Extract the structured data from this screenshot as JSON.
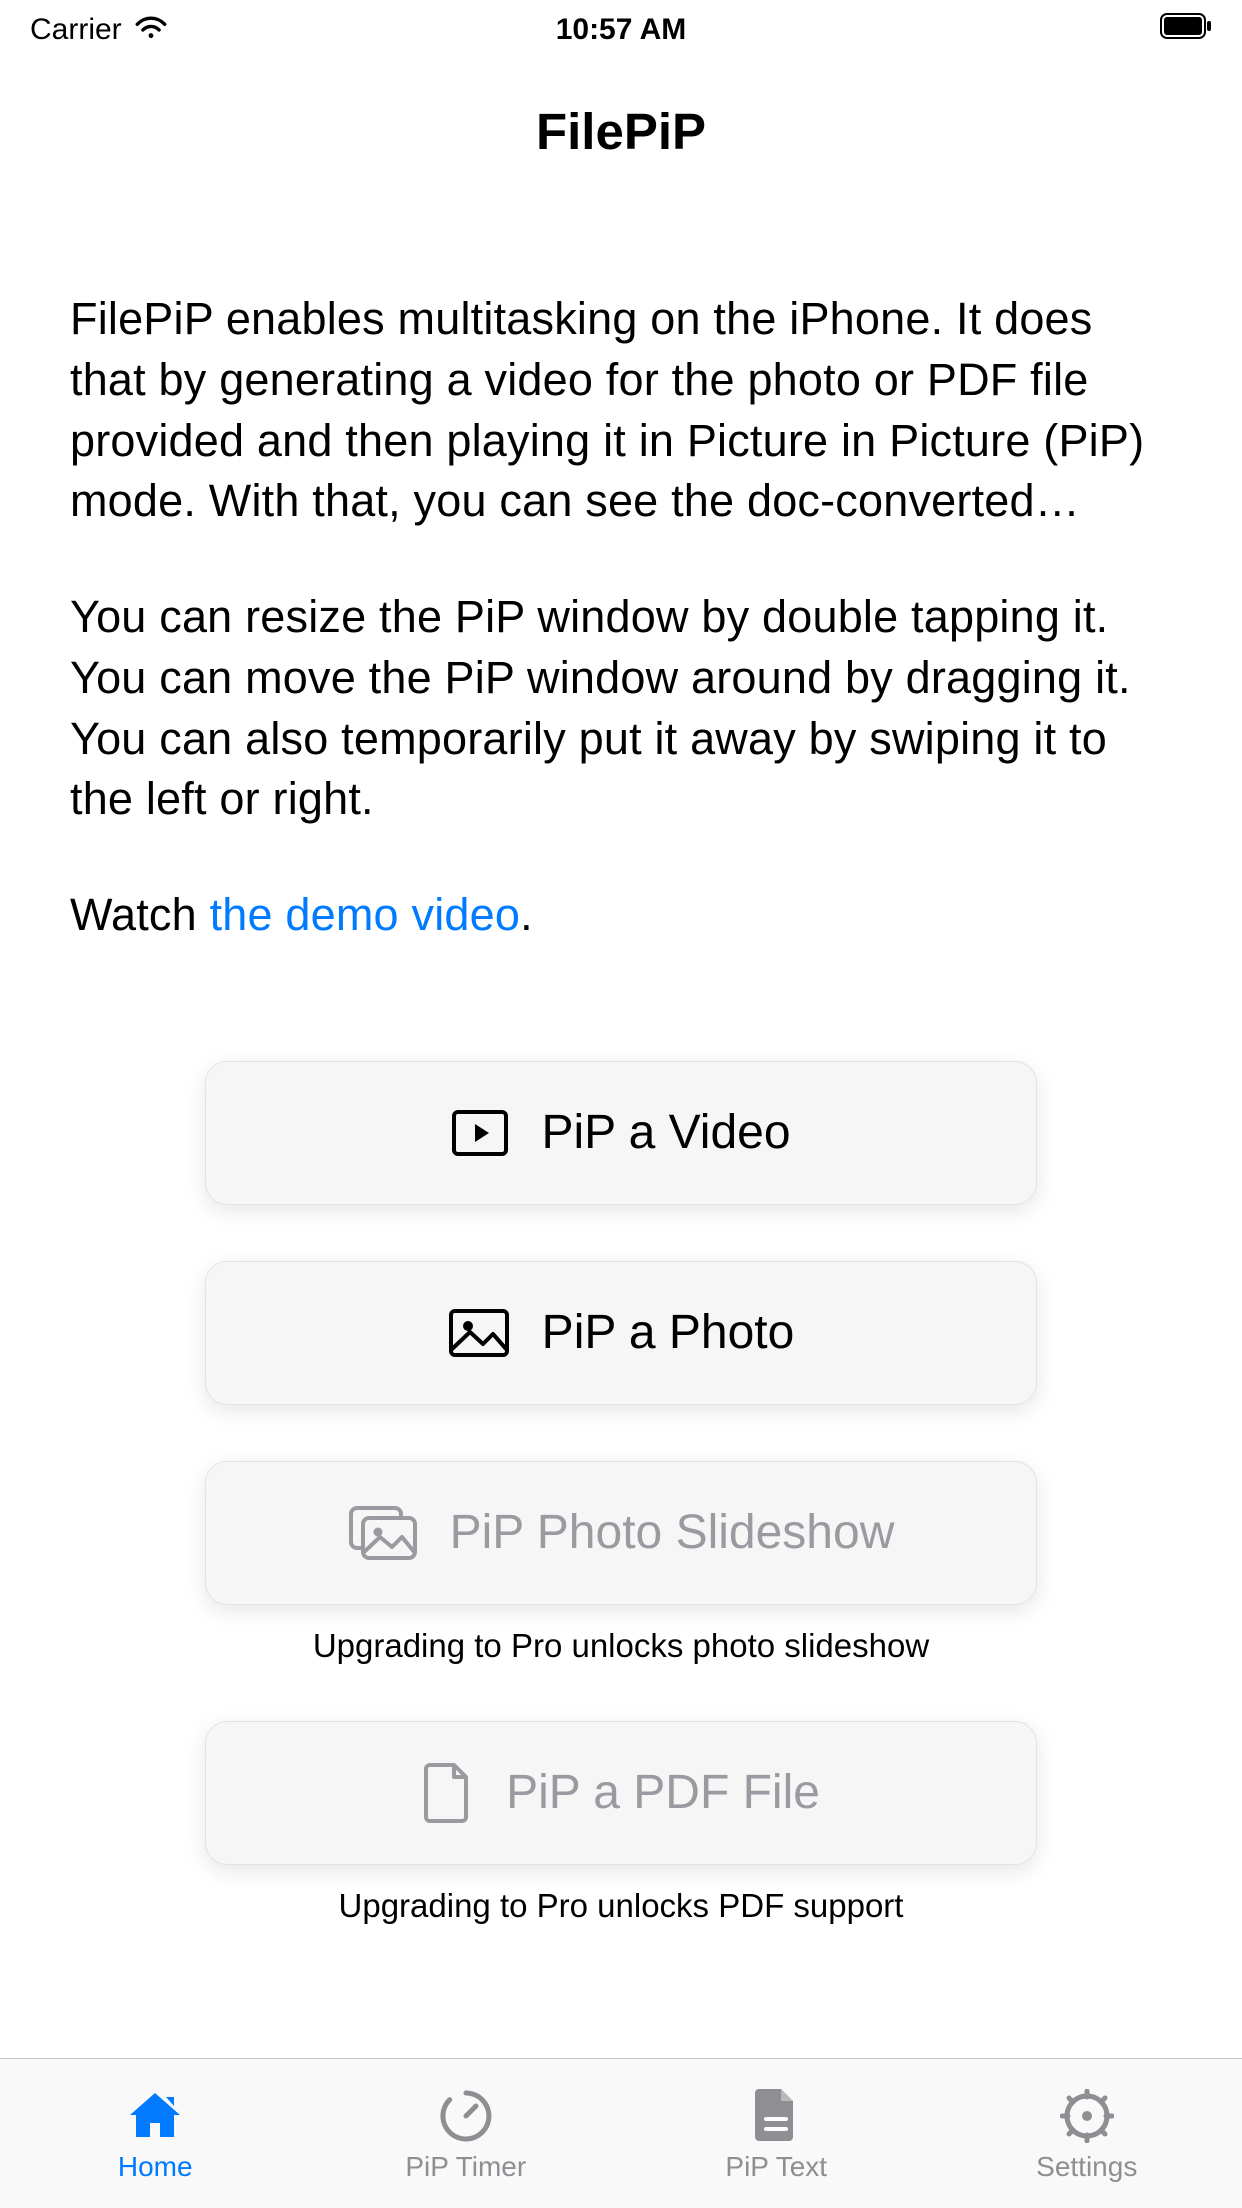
{
  "status_bar": {
    "carrier": "Carrier",
    "time": "10:57 AM"
  },
  "nav": {
    "title": "FilePiP"
  },
  "intro": {
    "p1": "FilePiP enables multitasking on the iPhone. It does that by generating a video for the photo or PDF file provided and then playing it in Picture in Picture (PiP) mode. With that, you can see the doc-converted…",
    "p2": "You can resize the PiP window by double tapping it. You can move the PiP window around by dragging it. You can also temporarily put it away by swiping it to the left or right.",
    "p3_pre": "Watch ",
    "p3_link": "the demo video",
    "p3_post": "."
  },
  "buttons": {
    "video": {
      "label": "PiP a Video"
    },
    "photo": {
      "label": "PiP a Photo"
    },
    "slideshow": {
      "label": "PiP Photo Slideshow",
      "caption": "Upgrading to Pro unlocks photo slideshow"
    },
    "pdf": {
      "label": "PiP a PDF File",
      "caption": "Upgrading to Pro unlocks PDF support"
    }
  },
  "tabs": {
    "home": {
      "label": "Home"
    },
    "timer": {
      "label": "PiP Timer"
    },
    "text": {
      "label": "PiP Text"
    },
    "settings": {
      "label": "Settings"
    }
  }
}
